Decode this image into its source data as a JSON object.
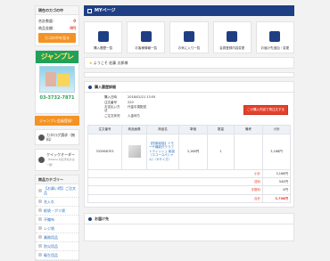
{
  "sidebar": {
    "cart_title": "現在のカゴの中",
    "cart_count_label": "合計数量：",
    "cart_count_value": "0",
    "cart_total_label": "商品金額：",
    "cart_total_value": "0円",
    "cart_button": "カゴの中を見る",
    "banner_title": "ジャンプレ",
    "banner_tel": "03-3732-7871",
    "banner_link": "ジャンプレ会員登録！",
    "catalog_label": "カタログ請求（無料）",
    "quick_label": "クイックオーダー",
    "quick_sub": "（Mobile 対応手続きは一部）",
    "category_title": "商品カテゴリー",
    "categories": [
      "【お買い得】ご注文品",
      "名入れ",
      "紙袋・ポリ袋",
      "不織布",
      "レジ袋",
      "業務用品",
      "防災用品",
      "衛生用品"
    ]
  },
  "main": {
    "page_title": "MYページ",
    "menu": [
      "購入履歴一覧",
      "お客様情報一覧",
      "お気に入り一覧",
      "会員登録内容変更",
      "お届け先追加・変更"
    ],
    "welcome_prefix": "ようこそ",
    "welcome_name": "佐藤 太郎様",
    "order_panel_title": "購入履歴詳細",
    "order_info": [
      {
        "k": "購入日時",
        "v": "2018/02/21 13:55"
      },
      {
        "k": "注文番号",
        "v": "220"
      },
      {
        "k": "お支払い方法",
        "v": "代金引換配送"
      },
      {
        "k": "ご注文状況",
        "v": "入金待ち"
      }
    ],
    "reorder_button": "この購入内容で再注文する",
    "table_headers": [
      "注文番号",
      "商品画像",
      "商品名",
      "単価",
      "数量",
      "備考",
      "小計"
    ],
    "row": {
      "code": "3329687E3",
      "name": "【防衛紙袋】ミモーザ機能付クラフトティッシュ 紙袋（エコースペシャル）（Sサイズ）",
      "price": "3,168円",
      "qty": "1",
      "subtotal": "3,168円"
    },
    "summary": [
      {
        "label": "小計",
        "value": "3,168円"
      },
      {
        "label": "送料",
        "value": "540円"
      },
      {
        "label": "手数料",
        "value": "0円"
      },
      {
        "label": "合計",
        "value": "3,708円"
      }
    ],
    "delivery_panel_title": "お届け先"
  }
}
